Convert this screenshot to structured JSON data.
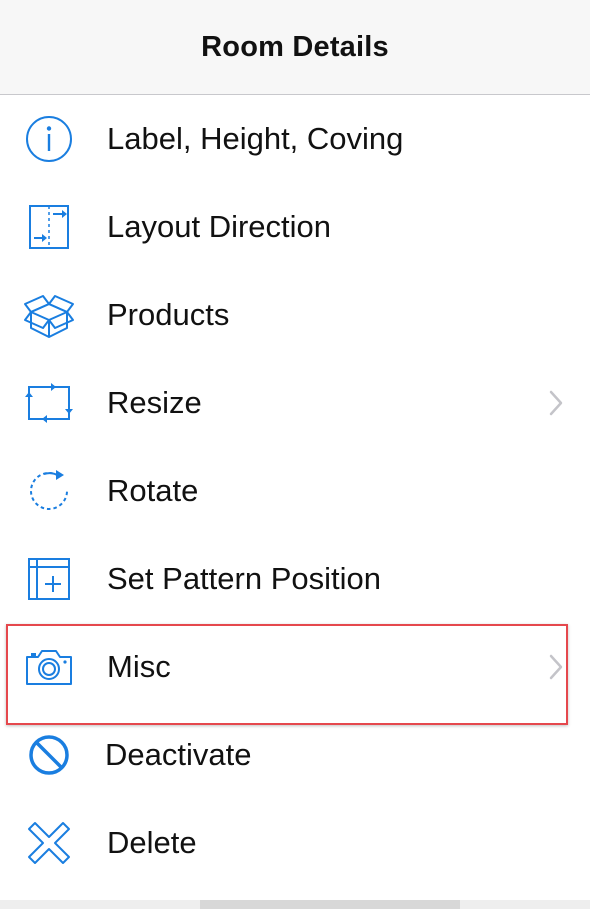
{
  "header": {
    "title": "Room Details"
  },
  "menu": {
    "items": [
      {
        "label": "Label, Height, Coving",
        "icon": "info-icon",
        "has_chevron": false
      },
      {
        "label": "Layout Direction",
        "icon": "layout-direction-icon",
        "has_chevron": false
      },
      {
        "label": "Products",
        "icon": "products-box-icon",
        "has_chevron": false
      },
      {
        "label": "Resize",
        "icon": "resize-icon",
        "has_chevron": true
      },
      {
        "label": "Rotate",
        "icon": "rotate-icon",
        "has_chevron": false
      },
      {
        "label": "Set Pattern Position",
        "icon": "pattern-position-icon",
        "has_chevron": false
      },
      {
        "label": "Misc",
        "icon": "camera-icon",
        "has_chevron": true,
        "highlighted": true
      },
      {
        "label": "Deactivate",
        "icon": "deactivate-icon",
        "has_chevron": false
      },
      {
        "label": "Delete",
        "icon": "delete-icon",
        "has_chevron": false
      }
    ]
  },
  "colors": {
    "accent": "#1a7ee0",
    "highlight_border": "#e5484d",
    "header_bg": "#f7f7f7",
    "chevron": "#c4c4c9"
  }
}
